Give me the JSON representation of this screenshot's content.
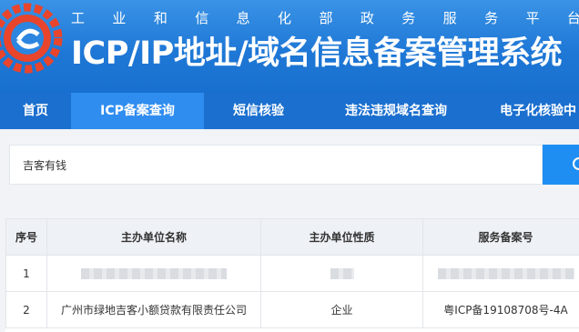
{
  "header": {
    "subtitle_chars": [
      "工",
      "业",
      "和",
      "信",
      "息",
      "化",
      "部",
      "政",
      "务",
      "服",
      "务",
      "平",
      "台"
    ],
    "title": "ICP/IP地址/域名信息备案管理系统"
  },
  "nav": {
    "items": [
      {
        "label": "首页",
        "active": false
      },
      {
        "label": "ICP备案查询",
        "active": true
      },
      {
        "label": "短信核验",
        "active": false
      },
      {
        "label": "违法违规域名查询",
        "active": false
      },
      {
        "label": "电子化核验中",
        "active": false
      }
    ]
  },
  "search": {
    "value": "吉客有钱",
    "button_icon": "search-icon"
  },
  "table": {
    "headers": [
      "序号",
      "主办单位名称",
      "主办单位性质",
      "服务备案号"
    ],
    "rows": [
      {
        "index": "1",
        "name": "",
        "nature": "",
        "license": "",
        "redacted": true
      },
      {
        "index": "2",
        "name": "广州市绿地吉客小额贷款有限责任公司",
        "nature": "企业",
        "license": "粤ICP备19108708号-4A",
        "redacted": false
      }
    ]
  },
  "colors": {
    "header_blue": "#1f78d6",
    "nav_blue": "#1a6fcf",
    "nav_active": "#2f8df0",
    "search_button": "#1e8ef2"
  }
}
